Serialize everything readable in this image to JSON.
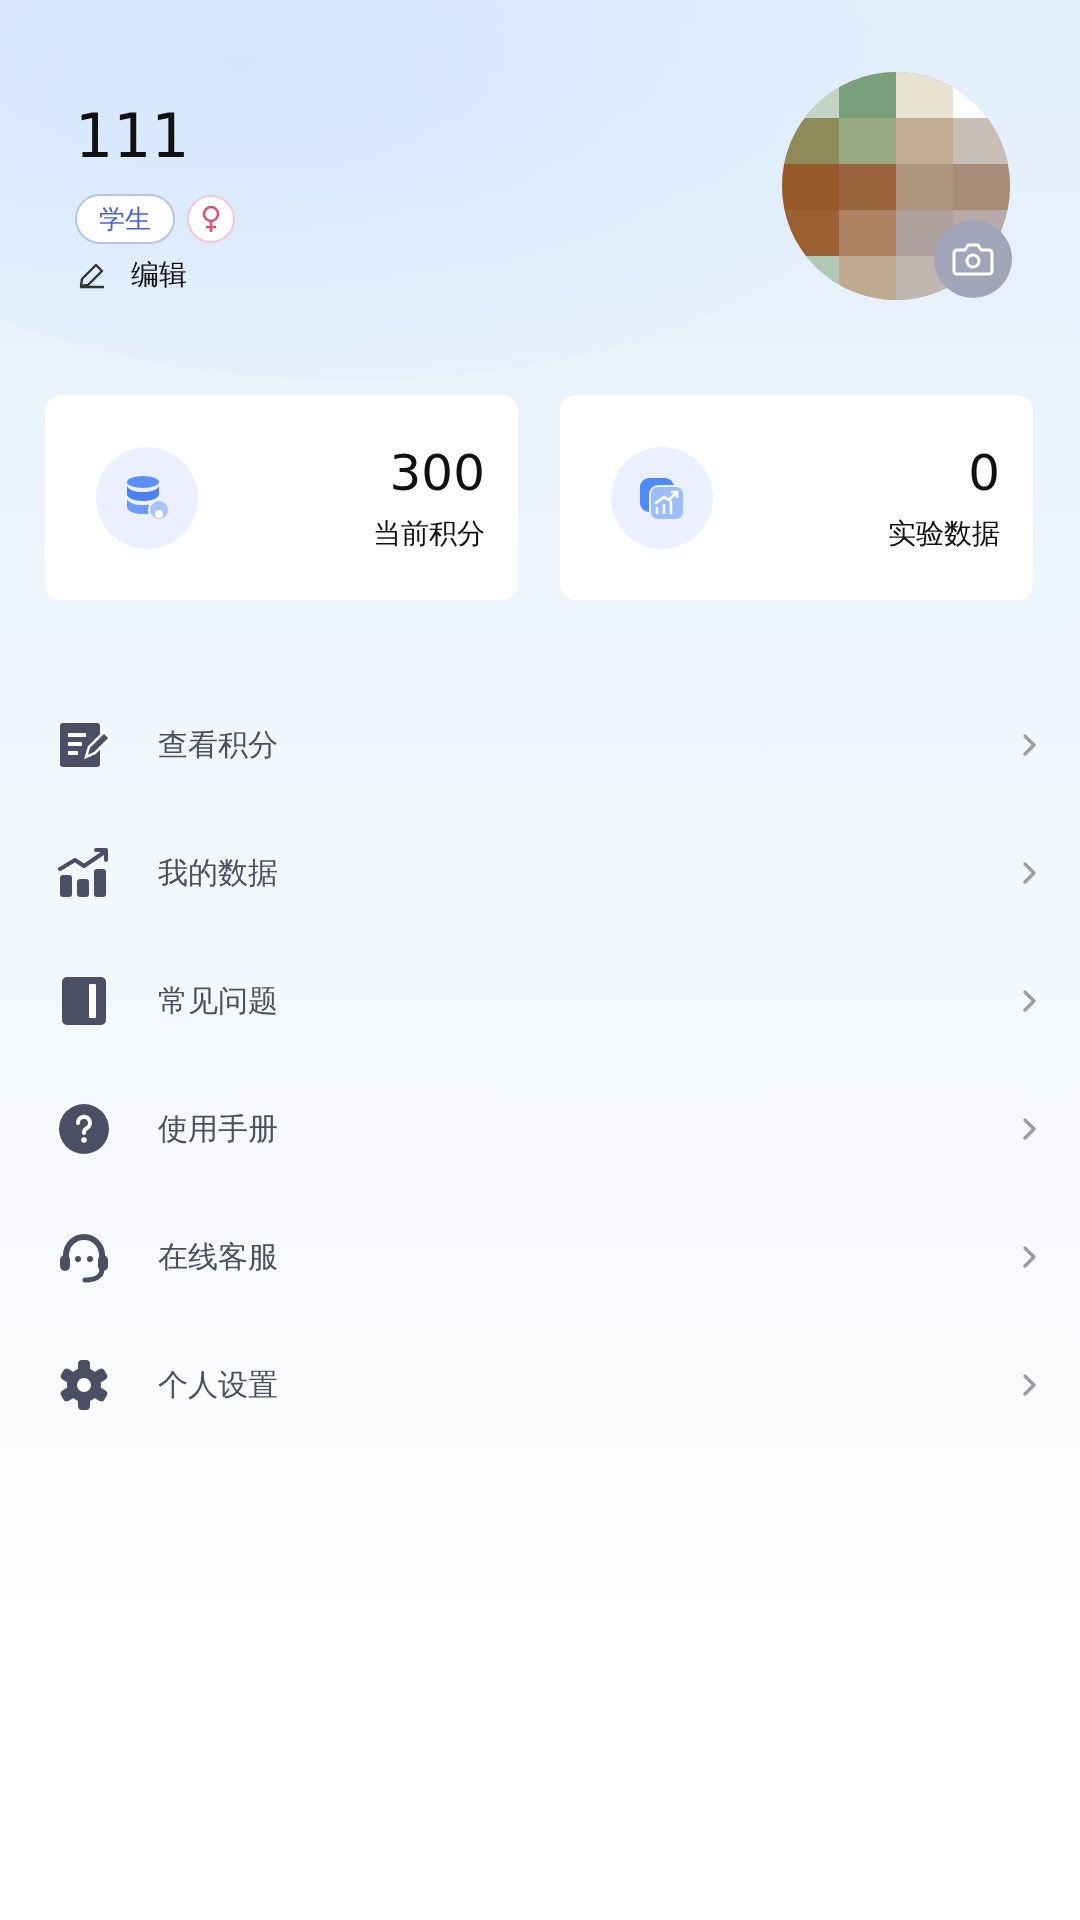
{
  "profile": {
    "name": "111",
    "role_tag": "学生",
    "female": true,
    "edit_label": "编辑"
  },
  "stats": [
    {
      "kind": "points",
      "value": "300",
      "label": "当前积分"
    },
    {
      "kind": "data",
      "value": "0",
      "label": "实验数据"
    }
  ],
  "menu": [
    {
      "kind": "notes",
      "label": "查看积分"
    },
    {
      "kind": "chart",
      "label": "我的数据"
    },
    {
      "kind": "book",
      "label": "常见问题"
    },
    {
      "kind": "help",
      "label": "使用手册"
    },
    {
      "kind": "support",
      "label": "在线客服"
    },
    {
      "kind": "settings",
      "label": "个人设置"
    }
  ]
}
